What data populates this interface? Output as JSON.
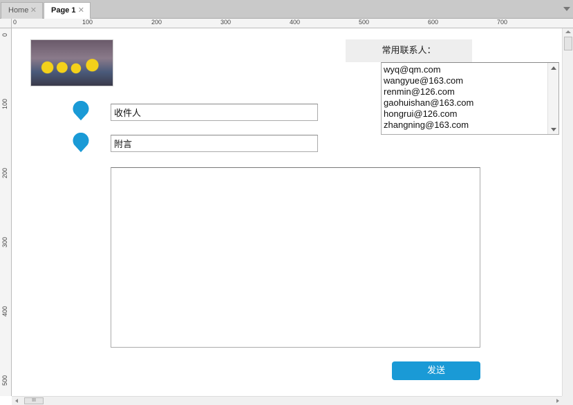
{
  "tabs": {
    "home": {
      "label": "Home",
      "close": "✕"
    },
    "page1": {
      "label": "Page 1",
      "close": "✕"
    }
  },
  "ruler": {
    "top_labels": [
      "0",
      "100",
      "200",
      "300",
      "400",
      "500",
      "600",
      "700"
    ],
    "left_labels": [
      "0",
      "100",
      "200",
      "300",
      "400",
      "500"
    ]
  },
  "form": {
    "recipient": {
      "value": "收件人"
    },
    "message": {
      "value": "附言"
    },
    "body": {
      "value": ""
    }
  },
  "contacts": {
    "header": "常用联系人：",
    "items": [
      "wyq@qm.com",
      "wangyue@163.com",
      "renmin@126.com",
      "gaohuishan@163.com",
      "hongrui@126.com",
      "zhangning@163.com"
    ]
  },
  "actions": {
    "send_label": "发送"
  },
  "scrollbar": {
    "grip": "III"
  },
  "colors": {
    "accent": "#1a9ad6",
    "pin": "#1a9ad6"
  },
  "icons": {
    "pin": "map-pin-icon",
    "close": "close-icon",
    "menu": "chevron-down-icon"
  }
}
